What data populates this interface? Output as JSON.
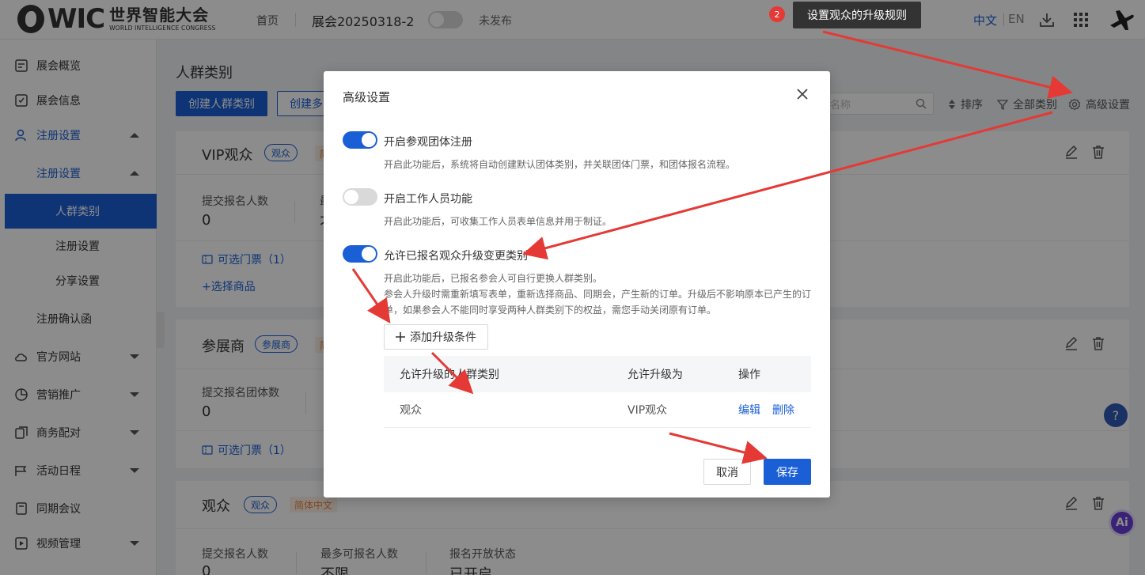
{
  "header": {
    "logo_mark": "WIC",
    "logo_cn": "世界智能大会",
    "logo_en": "WORLD INTELLIGENCE CONGRESS",
    "home": "首页",
    "expo_name": "展会20250318-2",
    "publish_status": "未发布",
    "lang_zh": "中文",
    "lang_en": "EN",
    "icons": [
      "download-icon",
      "apps-grid-icon",
      "plane-icon"
    ]
  },
  "sidebar": {
    "items": [
      {
        "label": "展会概览",
        "icon": "overview-icon"
      },
      {
        "label": "展会信息",
        "icon": "info-icon"
      },
      {
        "label": "注册设置",
        "icon": "user-icon",
        "expanded": true
      },
      {
        "label": "官方网站",
        "icon": "cloud-icon"
      },
      {
        "label": "营销推广",
        "icon": "pie-icon"
      },
      {
        "label": "商务配对",
        "icon": "copy-icon"
      },
      {
        "label": "活动日程",
        "icon": "schedule-icon"
      },
      {
        "label": "同期会议",
        "icon": "meeting-icon"
      },
      {
        "label": "视频管理",
        "icon": "video-icon"
      }
    ],
    "sub_group": "注册设置",
    "sub_items": [
      "人群类别",
      "注册设置",
      "分享设置"
    ],
    "confirm_letter": "注册确认函"
  },
  "main": {
    "title": "人群类别",
    "create_btn": "创建人群类别",
    "create_btn2": "创建多",
    "search_placeholder": "名称",
    "sort": "排序",
    "filter": "全部类别",
    "advanced": "高级设置",
    "cards": [
      {
        "title": "VIP观众",
        "tag": "观众",
        "tag2": "简",
        "stats": [
          {
            "label": "提交报名人数",
            "value": "0"
          },
          {
            "label": "最",
            "value": "不"
          }
        ],
        "link1": "可选门票（1）",
        "link2": "+选择商品"
      },
      {
        "title": "参展商",
        "tag": "参展商",
        "tag2": "简",
        "stats": [
          {
            "label": "提交报名团体数",
            "value": "0"
          }
        ],
        "link1": "可选门票（1）"
      },
      {
        "title": "观众",
        "tag": "观众",
        "tag2": "简体中文",
        "stats": [
          {
            "label": "提交报名人数",
            "value": "0"
          },
          {
            "label": "最多可报名人数",
            "value": "不限"
          },
          {
            "label": "报名开放状态",
            "value": "已开启"
          }
        ]
      }
    ],
    "help": "?",
    "ai": "Ai"
  },
  "annotation": {
    "badge": "2",
    "text": "设置观众的升级规则"
  },
  "modal": {
    "title": "高级设置",
    "options": [
      {
        "label": "开启参观团体注册",
        "on": true,
        "desc": "开启此功能后，系统将自动创建默认团体类别，并关联团体门票，和团体报名流程。"
      },
      {
        "label": "开启工作人员功能",
        "on": false,
        "desc": "开启此功能后，可收集工作人员表单信息并用于制证。"
      },
      {
        "label": "允许已报名观众升级变更类别",
        "on": true,
        "desc": "开启此功能后，已报名参会人可自行更换人群类别。",
        "desc2": "参会人升级时需重新填写表单，重新选择商品、同期会，产生新的订单。升级后不影响原本已产生的订",
        "desc3": "单，如果参会人不能同时享受两种人群类别下的权益，需您手动关闭原有订单。"
      }
    ],
    "add_btn": "添加升级条件",
    "table": {
      "headers": [
        "允许升级的人群类别",
        "允许升级为",
        "操作"
      ],
      "rows": [
        {
          "from": "观众",
          "to": "VIP观众",
          "edit": "编辑",
          "delete": "删除"
        }
      ]
    },
    "cancel": "取消",
    "save": "保存"
  },
  "colors": {
    "primary": "#1a5fd6",
    "annotation_red": "#e53935",
    "tag_orange": "#e8843a"
  }
}
